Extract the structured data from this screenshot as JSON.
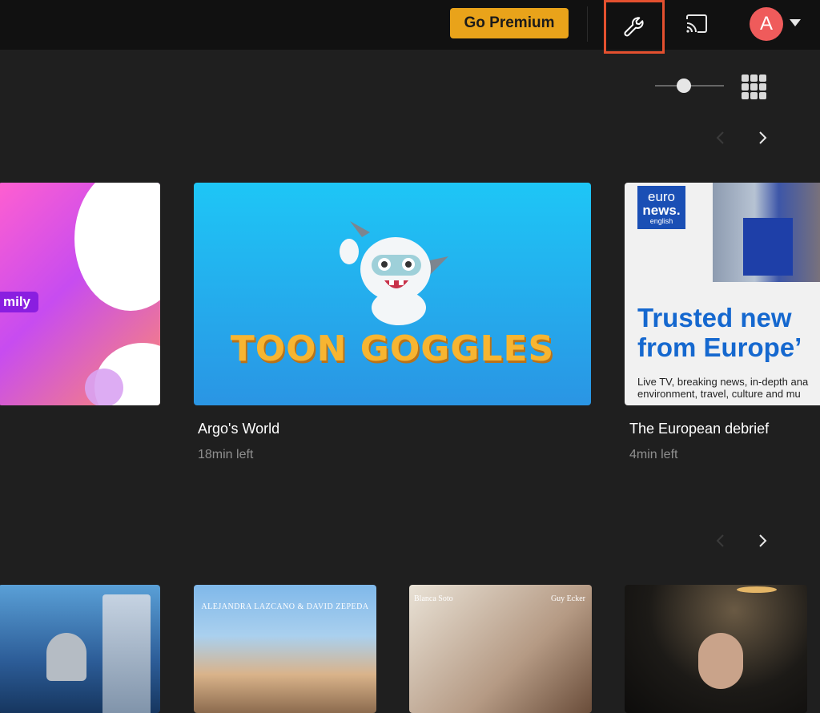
{
  "header": {
    "premium_label": "Go Premium",
    "settings_icon": "wrench-icon",
    "cast_icon": "cast-icon",
    "avatar_initial": "A",
    "menu_icon": "caret-down-icon"
  },
  "controls": {
    "tile_size_level": 0.4,
    "view_icon": "grid-view-icon"
  },
  "rows": [
    {
      "items": [
        {
          "tag": "mily"
        },
        {
          "logo_text": "TOON GOGGLES",
          "title": "Argo's World",
          "subtitle": "18min left"
        },
        {
          "logo_line1": "euro",
          "logo_line2": "news.",
          "logo_line3": "english",
          "headline_1": "Trusted new",
          "headline_2": "from Europe’",
          "body_1": "Live TV, breaking news, in-depth ana",
          "body_2": "environment, travel, culture and mu",
          "title": "The European debrief",
          "subtitle": "4min left"
        }
      ]
    },
    {
      "items": [
        {
          "poster_text": ""
        },
        {
          "poster_text": "ALEJANDRA LAZCANO & DAVID ZEPEDA"
        },
        {
          "poster_left": "Blanca Soto",
          "poster_right": "Guy Ecker"
        },
        {
          "poster_text": ""
        }
      ]
    }
  ],
  "colors": {
    "accent": "#e9a31a",
    "highlight": "#e4502f",
    "avatar": "#ef5b5b"
  }
}
